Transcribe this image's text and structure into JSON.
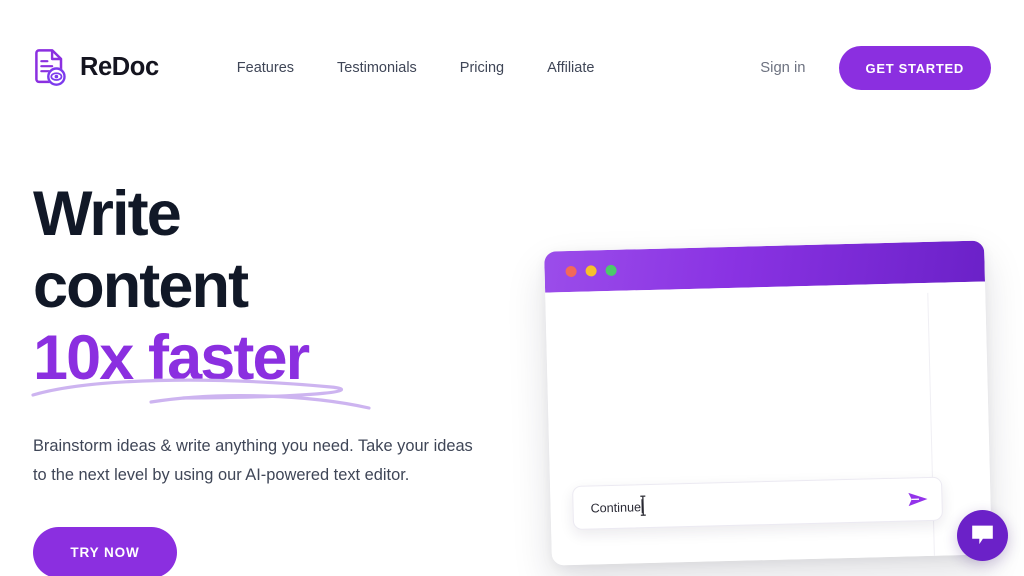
{
  "brand": {
    "name": "ReDoc",
    "icon": "document-eye-icon"
  },
  "nav": {
    "items": [
      {
        "label": "Features"
      },
      {
        "label": "Testimonials"
      },
      {
        "label": "Pricing"
      },
      {
        "label": "Affiliate"
      }
    ]
  },
  "header": {
    "signin_label": "Sign in",
    "cta_label": "GET STARTED"
  },
  "hero": {
    "headline_line1": "Write",
    "headline_line2": "content",
    "headline_accent": "10x faster",
    "subtext": "Brainstorm ideas & write anything you need. Take your ideas to the next level by using our AI-powered text editor.",
    "try_label": "TRY NOW"
  },
  "mockup": {
    "dots": [
      {
        "name": "close",
        "color": "#f2695a"
      },
      {
        "name": "minimize",
        "color": "#f7c02c"
      },
      {
        "name": "maximize",
        "color": "#4cca6a"
      }
    ],
    "composer_value": "Continue",
    "composer_placeholder": "Continue",
    "send_icon": "send-arrow-icon"
  },
  "chat": {
    "icon": "chat-bubble-icon"
  },
  "colors": {
    "accent": "#8b2fe0",
    "accent_dark": "#6b21c8",
    "accent_light": "#9b4dea",
    "headline": "#111827",
    "body_text": "#3f4657",
    "muted": "#6d7280",
    "swoosh": "#cdb4f0"
  }
}
